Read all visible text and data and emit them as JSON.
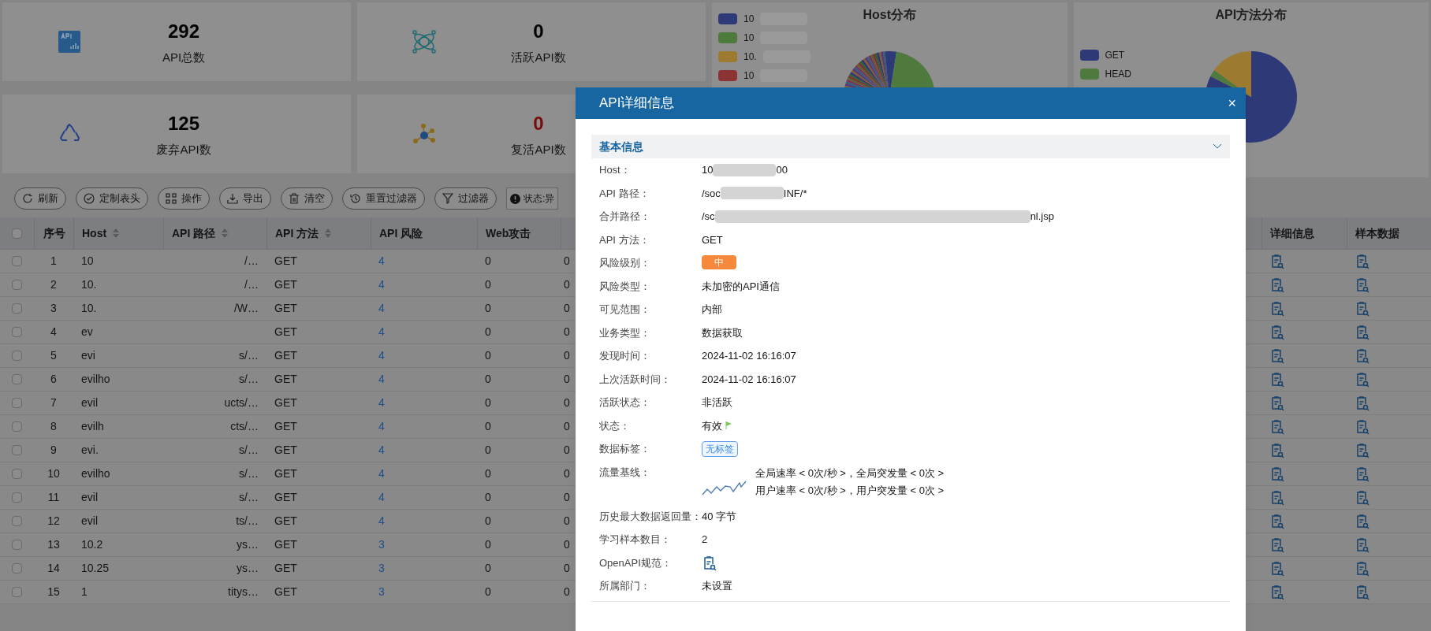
{
  "stats": [
    {
      "value": "292",
      "label": "API总数",
      "color": "#000000"
    },
    {
      "value": "0",
      "label": "活跃API数",
      "color": "#000000"
    },
    {
      "value": "125",
      "label": "废弃API数",
      "color": "#000000"
    },
    {
      "value": "0",
      "label": "复活API数",
      "color": "#7a0a0a"
    }
  ],
  "host_chart": {
    "title": "Host分布",
    "legend": [
      {
        "label": "10",
        "color": "#2e3a78"
      },
      {
        "label": "10",
        "color": "#4e7a3d"
      },
      {
        "label": "10.",
        "color": "#9c7a30"
      },
      {
        "label": "10",
        "color": "#8c3434"
      }
    ]
  },
  "method_chart": {
    "title": "API方法分布",
    "legend": [
      {
        "label": "GET",
        "color": "#2e3a78"
      },
      {
        "label": "HEAD",
        "color": "#4e7a3d"
      }
    ]
  },
  "toolbar": [
    "刷新",
    "定制表头",
    "操作",
    "导出",
    "清空",
    "重置过滤器",
    "过滤器"
  ],
  "filter_chip": "状态:异",
  "table": {
    "all_checked": false,
    "columns": [
      "序号",
      "Host",
      "API 路径",
      "API 方法",
      "API 风险",
      "Web攻击"
    ],
    "right_columns": [
      "详细信息",
      "样本数据"
    ],
    "rows": [
      {
        "no": "1",
        "host": "10",
        "path": "/…",
        "method": "GET",
        "risk": "4",
        "web": "0",
        "col_7": "0",
        "checked": false
      },
      {
        "no": "2",
        "host": "10.",
        "path": "/…",
        "method": "GET",
        "risk": "4",
        "web": "0",
        "col_7": "0",
        "checked": false
      },
      {
        "no": "3",
        "host": "10.",
        "path": "/W…",
        "method": "GET",
        "risk": "4",
        "web": "0",
        "col_7": "0",
        "checked": false
      },
      {
        "no": "4",
        "host": "ev",
        "method": "GET",
        "risk": "4",
        "web": "0",
        "col_7": "0",
        "checked": false
      },
      {
        "no": "5",
        "host": "evi",
        "path": "s/…",
        "method": "GET",
        "risk": "4",
        "web": "0",
        "col_7": "0",
        "checked": false
      },
      {
        "no": "6",
        "host": "evilho",
        "path": "s/…",
        "method": "GET",
        "risk": "4",
        "web": "0",
        "col_7": "0",
        "checked": false
      },
      {
        "no": "7",
        "host": "evil",
        "path": "ucts/…",
        "method": "GET",
        "risk": "4",
        "web": "0",
        "col_7": "0",
        "checked": false
      },
      {
        "no": "8",
        "host": "evilh",
        "path": "cts/…",
        "method": "GET",
        "risk": "4",
        "web": "0",
        "col_7": "0",
        "checked": false
      },
      {
        "no": "9",
        "host": "evi.",
        "path": "s/…",
        "method": "GET",
        "risk": "4",
        "web": "0",
        "col_7": "0",
        "checked": false
      },
      {
        "no": "10",
        "host": "evilho",
        "path": "s/…",
        "method": "GET",
        "risk": "4",
        "web": "0",
        "col_7": "0",
        "checked": false
      },
      {
        "no": "11",
        "host": "evil",
        "path": "s/…",
        "method": "GET",
        "risk": "4",
        "web": "0",
        "col_7": "0",
        "checked": false
      },
      {
        "no": "12",
        "host": "evil",
        "path": "ts/…",
        "method": "GET",
        "risk": "4",
        "web": "0",
        "col_7": "0",
        "checked": false
      },
      {
        "no": "13",
        "host": "10.2",
        "path": "ys…",
        "method": "GET",
        "risk": "3",
        "web": "0",
        "col_7": "0",
        "checked": false
      },
      {
        "no": "14",
        "host": "10.25",
        "path": "ys…",
        "method": "GET",
        "risk": "3",
        "web": "0",
        "col_7": "0",
        "checked": false
      },
      {
        "no": "15",
        "host": "1",
        "path": "titys…",
        "method": "GET",
        "risk": "3",
        "web": "0",
        "col_7": "0",
        "checked": false
      }
    ]
  },
  "modal": {
    "title": "API详细信息",
    "close": "×",
    "section": {
      "title": "基本信息",
      "expanded": true
    },
    "fields": [
      {
        "kind": "redacted",
        "label": "Host：",
        "parts": [
          "10",
          "00"
        ]
      },
      {
        "kind": "redacted",
        "label": "API 路径：",
        "parts": [
          "/soc",
          "INF/*"
        ]
      },
      {
        "kind": "redacted",
        "label": "合并路径：",
        "parts": [
          "/sc",
          "nl.jsp"
        ]
      },
      {
        "kind": "text",
        "label": "API 方法：",
        "value": "GET"
      },
      {
        "kind": "badge",
        "label": "风险级别：",
        "value": "中",
        "color": "#f5883a"
      },
      {
        "kind": "text",
        "label": "风险类型：",
        "value": "未加密的API通信"
      },
      {
        "kind": "text",
        "label": "可见范围：",
        "value": "内部"
      },
      {
        "kind": "text",
        "label": "业务类型：",
        "value": "数据获取"
      },
      {
        "kind": "text",
        "label": "发现时间：",
        "value": "2024-11-02 16:16:07"
      },
      {
        "kind": "text",
        "label": "上次活跃时间：",
        "value": "2024-11-02 16:16:07"
      },
      {
        "kind": "text",
        "label": "活跃状态：",
        "value": "非活跃"
      },
      {
        "kind": "status",
        "label": "状态：",
        "value": "有效"
      },
      {
        "kind": "tag",
        "label": "数据标签：",
        "value": "无标签"
      },
      {
        "kind": "baseline",
        "label": "流量基线：",
        "lines": [
          "全局速率 < 0次/秒 >，全局突发量 < 0次 >",
          "用户速率 < 0次/秒 >，用户突发量 < 0次 >"
        ]
      },
      {
        "kind": "text",
        "label": "历史最大数据返回量：",
        "value": "40 字节"
      },
      {
        "kind": "text",
        "label": "学习样本数目：",
        "value": "2"
      },
      {
        "kind": "icon",
        "label": "OpenAPI规范："
      },
      {
        "kind": "text",
        "label": "所属部门：",
        "value": "未设置"
      }
    ]
  }
}
